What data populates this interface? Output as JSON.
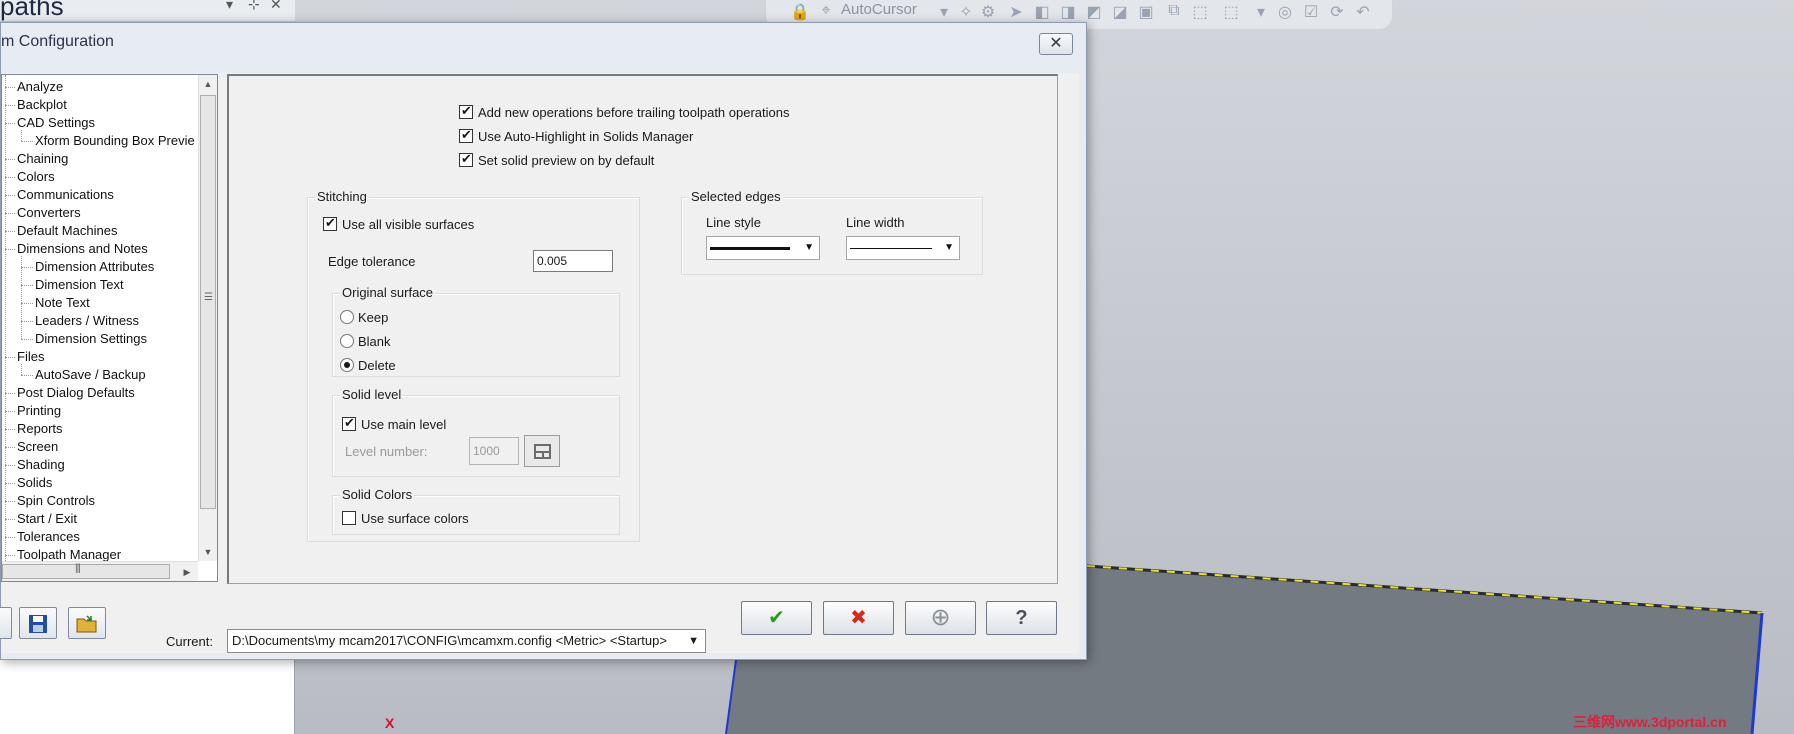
{
  "background": {
    "panel_title": "paths",
    "toolbar": {
      "autocursor_label": "AutoCursor"
    },
    "axis_label": "X",
    "watermark": "三维网www.3dportal.cn"
  },
  "dialog": {
    "title": "m Configuration",
    "close_icon": "✕"
  },
  "tree": {
    "items": [
      {
        "label": "Analyze",
        "level": 0
      },
      {
        "label": "Backplot",
        "level": 0
      },
      {
        "label": "CAD Settings",
        "level": 0
      },
      {
        "label": "Xform Bounding Box Previe",
        "level": 1
      },
      {
        "label": "Chaining",
        "level": 0
      },
      {
        "label": "Colors",
        "level": 0
      },
      {
        "label": "Communications",
        "level": 0
      },
      {
        "label": "Converters",
        "level": 0
      },
      {
        "label": "Default Machines",
        "level": 0
      },
      {
        "label": "Dimensions and Notes",
        "level": 0
      },
      {
        "label": "Dimension Attributes",
        "level": 1
      },
      {
        "label": "Dimension Text",
        "level": 1
      },
      {
        "label": "Note Text",
        "level": 1
      },
      {
        "label": "Leaders / Witness",
        "level": 1
      },
      {
        "label": "Dimension Settings",
        "level": 1
      },
      {
        "label": "Files",
        "level": 0
      },
      {
        "label": "AutoSave / Backup",
        "level": 1
      },
      {
        "label": "Post Dialog Defaults",
        "level": 0
      },
      {
        "label": "Printing",
        "level": 0
      },
      {
        "label": "Reports",
        "level": 0
      },
      {
        "label": "Screen",
        "level": 0
      },
      {
        "label": "Shading",
        "level": 0
      },
      {
        "label": "Solids",
        "level": 0
      },
      {
        "label": "Spin Controls",
        "level": 0
      },
      {
        "label": "Start / Exit",
        "level": 0
      },
      {
        "label": "Tolerances",
        "level": 0
      },
      {
        "label": "Toolpath Manager",
        "level": 0
      }
    ]
  },
  "options": {
    "add_new_ops": {
      "label": "Add new operations before trailing toolpath operations",
      "checked": true
    },
    "auto_highlight": {
      "label": "Use Auto-Highlight in Solids Manager",
      "checked": true
    },
    "solid_preview": {
      "label": "Set solid preview on by default",
      "checked": true
    }
  },
  "stitching": {
    "label": "Stitching",
    "use_all_visible": {
      "label": "Use all visible surfaces",
      "checked": true
    },
    "edge_tolerance_label": "Edge tolerance",
    "edge_tolerance_value": "0.005",
    "original_surface": {
      "label": "Original surface",
      "options": [
        "Keep",
        "Blank",
        "Delete"
      ],
      "selected": "Delete"
    },
    "solid_level": {
      "label": "Solid level",
      "use_main_level": {
        "label": "Use main level",
        "checked": true
      },
      "level_number_label": "Level number:",
      "level_number_value": "1000"
    },
    "solid_colors": {
      "label": "Solid Colors",
      "use_surface_colors": {
        "label": "Use surface colors",
        "checked": false
      }
    }
  },
  "selected_edges": {
    "label": "Selected edges",
    "line_style_label": "Line style",
    "line_width_label": "Line width"
  },
  "bottom": {
    "current_label": "Current:",
    "current_value": "D:\\Documents\\my mcam2017\\CONFIG\\mcamxm.config <Metric> <Startup>",
    "ok_icon": "✔",
    "cancel_icon": "✖",
    "apply_icon": "⊕",
    "help_icon": "?"
  },
  "colors": {
    "ok_green": "#2a9a1e",
    "cancel_red": "#d42a1a",
    "model_face": "#737a82",
    "model_edge_highlight": "#e8e02a"
  }
}
